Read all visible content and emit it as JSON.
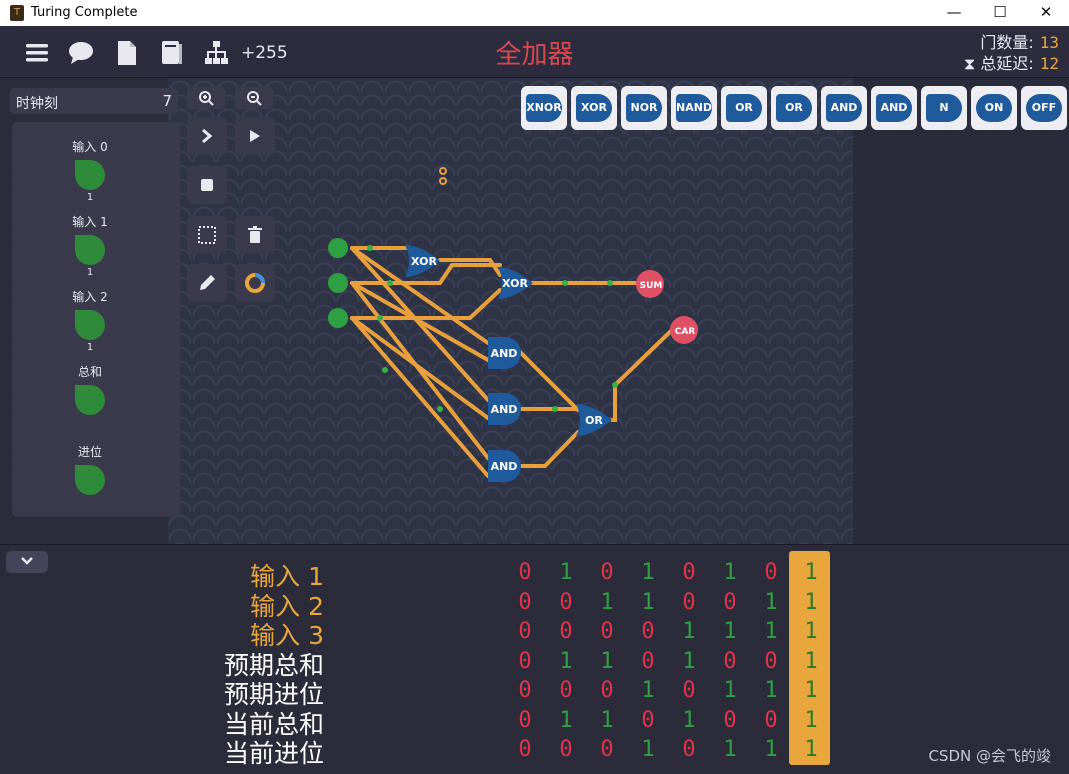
{
  "window": {
    "title": "Turing Complete",
    "min": "—",
    "max": "☐",
    "close": "✕",
    "icon": "T"
  },
  "topbar": {
    "count": "+255",
    "level_title": "全加器",
    "gate_count_label": "门数量:",
    "gate_count": "13",
    "delay_label": "总延迟:",
    "delay": "12",
    "delay_icon": "⧗"
  },
  "clock": {
    "label": "时钟刻",
    "value": "7"
  },
  "io": [
    {
      "label": "输入 0",
      "value": "1"
    },
    {
      "label": "输入 1",
      "value": "1"
    },
    {
      "label": "输入 2",
      "value": "1"
    },
    {
      "label": "总和",
      "value": ""
    },
    {
      "label": "进位",
      "value": ""
    }
  ],
  "palette": [
    "XNOR",
    "XOR",
    "NOR",
    "NAND",
    "OR",
    "OR",
    "AND",
    "AND",
    "N",
    "ON",
    "OFF"
  ],
  "circuit": {
    "xor1": "XOR",
    "xor2": "XOR",
    "and1": "AND",
    "and2": "AND",
    "and3": "AND",
    "or1": "OR",
    "sum": "SUM",
    "car": "CAR"
  },
  "truth_table": [
    {
      "label": "输入 1",
      "color": "#e8a63c",
      "values": [
        "0",
        "1",
        "0",
        "1",
        "0",
        "1",
        "0",
        "1"
      ]
    },
    {
      "label": "输入 2",
      "color": "#e8a63c",
      "values": [
        "0",
        "0",
        "1",
        "1",
        "0",
        "0",
        "1",
        "1"
      ]
    },
    {
      "label": "输入 3",
      "color": "#e8a63c",
      "values": [
        "0",
        "0",
        "0",
        "0",
        "1",
        "1",
        "1",
        "1"
      ]
    },
    {
      "label": "预期总和",
      "color": "#ffffff",
      "values": [
        "0",
        "1",
        "1",
        "0",
        "1",
        "0",
        "0",
        "1"
      ]
    },
    {
      "label": "预期进位",
      "color": "#ffffff",
      "values": [
        "0",
        "0",
        "0",
        "1",
        "0",
        "1",
        "1",
        "1"
      ]
    },
    {
      "label": "当前总和",
      "color": "#ffffff",
      "values": [
        "0",
        "1",
        "1",
        "0",
        "1",
        "0",
        "0",
        "1"
      ]
    },
    {
      "label": "当前进位",
      "color": "#ffffff",
      "values": [
        "0",
        "0",
        "0",
        "1",
        "0",
        "1",
        "1",
        "1"
      ]
    }
  ],
  "colors": {
    "zero": "#e0344a",
    "one": "#2ea043",
    "current": "#e8a63c",
    "wire": "#e8a03c",
    "gate": "#1f5a9c"
  },
  "watermark": "CSDN @会飞的竣"
}
